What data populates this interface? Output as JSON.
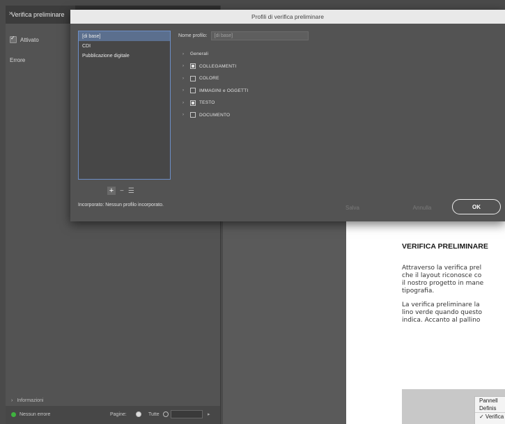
{
  "panel": {
    "tab_title": "Verifica preliminare",
    "enabled_label": "Attivato",
    "errors_label": "Errore",
    "info_label": "Informazioni",
    "status_text": "Nessun errore",
    "pages_label": "Pagine:",
    "all_label": "Tutte"
  },
  "document": {
    "heading": "VERIFICA PRELIMINARE",
    "paragraph1": [
      "Attraverso la verifica prel",
      "che il layout riconosce co",
      "il nostro progetto in mane",
      "tipografia."
    ],
    "paragraph2": [
      "La verifica preliminare la",
      "lino verde quando questo",
      "indica. Accanto al pallino"
    ],
    "menu_items": [
      "Pannell",
      "Definis",
      "✓ Verifica"
    ]
  },
  "dialog": {
    "title": "Profili di verifica preliminare",
    "profiles": [
      "[di base]",
      "CDI",
      "Pubblicazione digitale"
    ],
    "selected_profile_index": 0,
    "name_label": "Nome profilo:",
    "name_placeholder": "[di base]",
    "tree": [
      {
        "label": "Generali",
        "checkbox": "none"
      },
      {
        "label": "COLLEGAMENTI",
        "checkbox": "mixed"
      },
      {
        "label": "COLORE",
        "checkbox": "unchecked"
      },
      {
        "label": "IMMAGINI e OGGETTI",
        "checkbox": "unchecked"
      },
      {
        "label": "TESTO",
        "checkbox": "mixed"
      },
      {
        "label": "DOCUMENTO",
        "checkbox": "unchecked"
      }
    ],
    "embedded_text": "Incorporato: Nessun profilo incorporato.",
    "save_label": "Salva",
    "cancel_label": "Annulla",
    "ok_label": "OK"
  },
  "colors": {
    "status_ok": "#3fb33f",
    "selection": "#5b6f8e",
    "list_border": "#6d8fc7"
  }
}
